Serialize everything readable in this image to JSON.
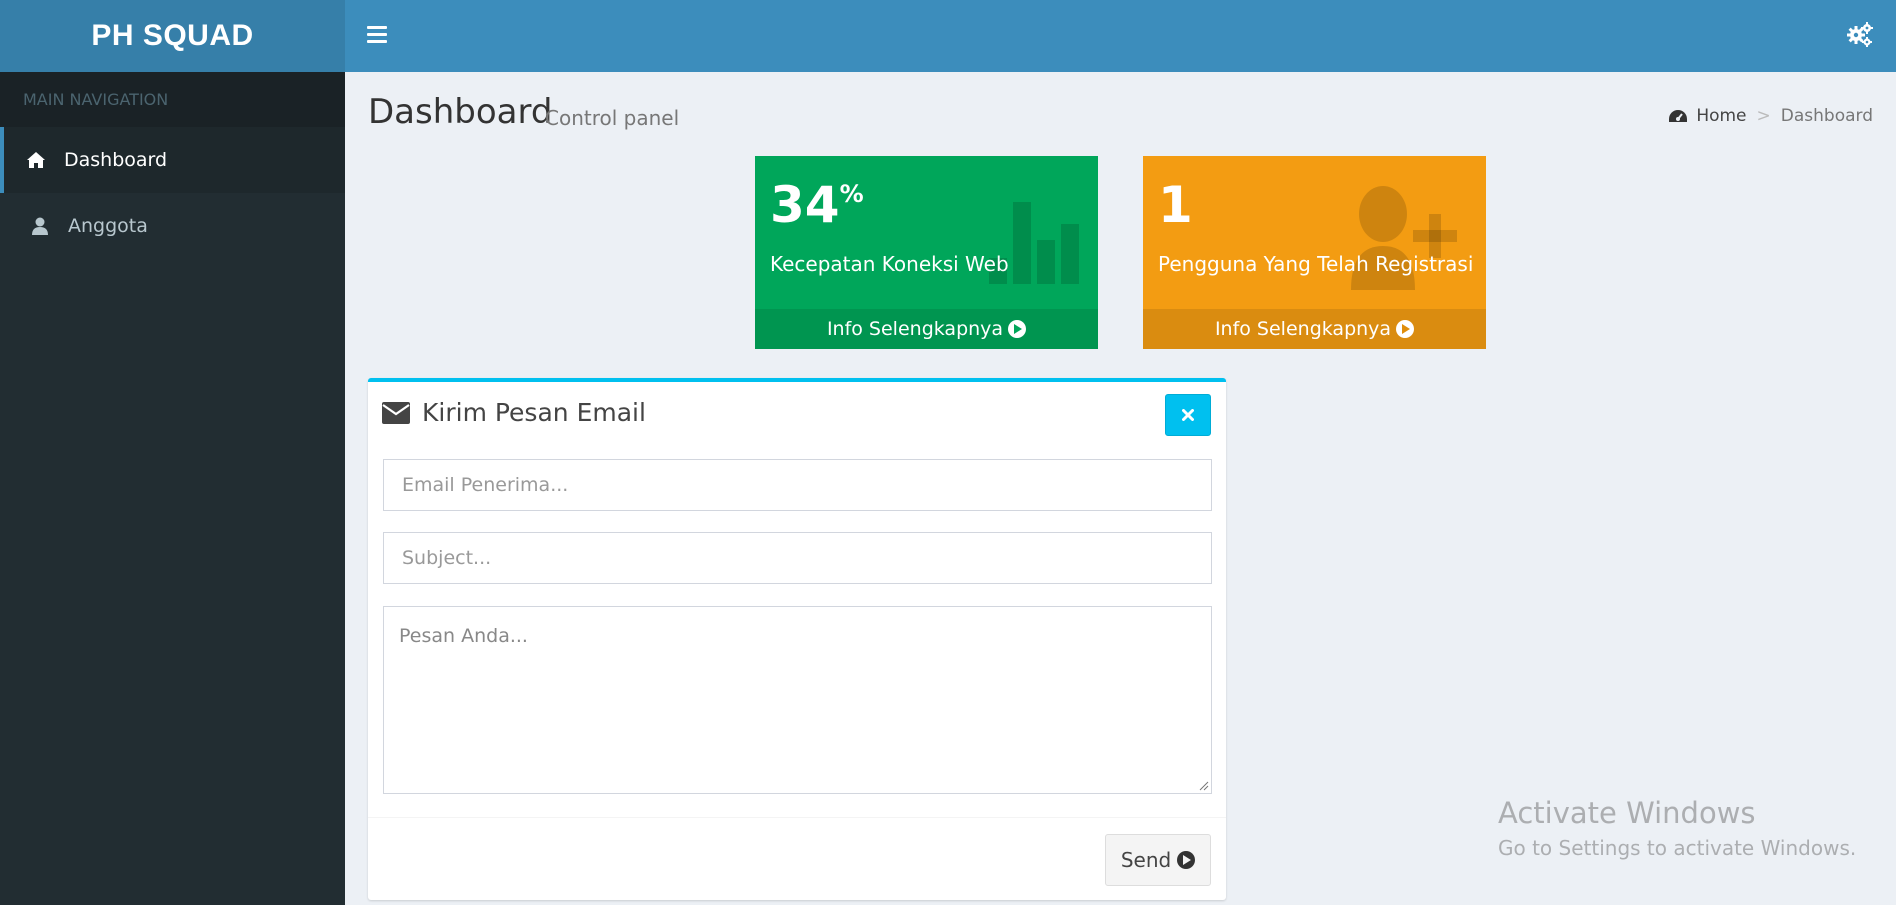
{
  "brand": {
    "title": "PH SQUAD"
  },
  "sidebar": {
    "header": "MAIN NAVIGATION",
    "items": [
      {
        "label": "Dashboard",
        "icon": "home-icon",
        "active": true
      },
      {
        "label": "Anggota",
        "icon": "user-icon",
        "active": false
      }
    ]
  },
  "header": {
    "title": "Dashboard",
    "subtitle": "Control panel",
    "breadcrumb": {
      "home": "Home",
      "separator": ">",
      "current": "Dashboard"
    }
  },
  "stats": [
    {
      "value": "34",
      "unit": "%",
      "label": "Kecepatan Koneksi Web",
      "footer": "Info Selengkapnya",
      "color": "#00a65a",
      "icon": "bar-chart-icon"
    },
    {
      "value": "1",
      "unit": "",
      "label": "Pengguna Yang Telah Registrasi",
      "footer": "Info Selengkapnya",
      "color": "#f39c12",
      "icon": "user-plus-icon"
    }
  ],
  "email_box": {
    "title": "Kirim Pesan Email",
    "fields": {
      "recipient_placeholder": "Email Penerima...",
      "subject_placeholder": "Subject...",
      "message_placeholder": "Pesan Anda..."
    },
    "send_label": "Send",
    "accent": "#00c0ef"
  },
  "watermark": {
    "line1": "Activate Windows",
    "line2": "Go to Settings to activate Windows."
  }
}
